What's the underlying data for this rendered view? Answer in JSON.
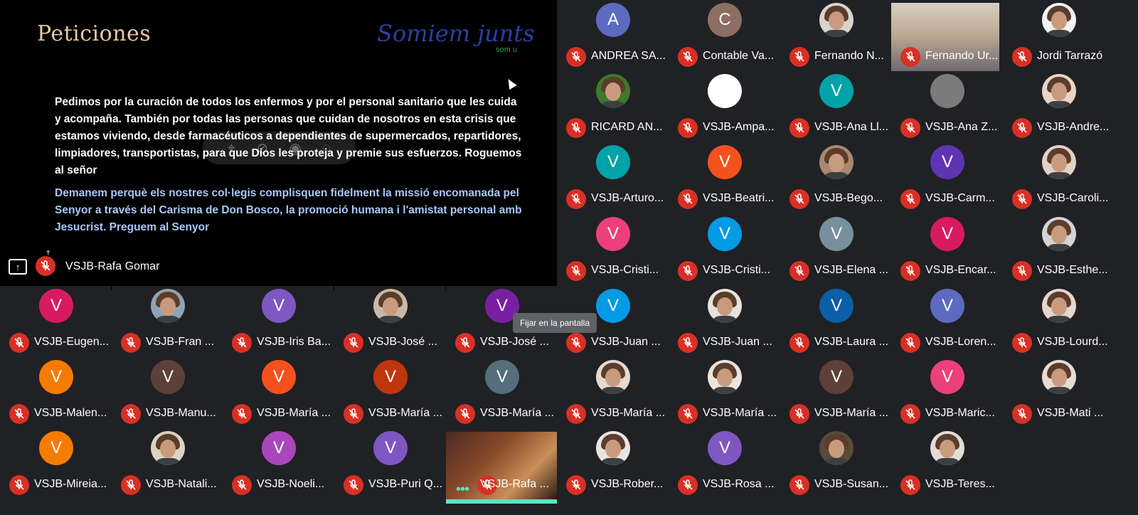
{
  "presentation": {
    "title": "Peticiones",
    "logo": "Somiem junts",
    "logo_sub": "som u",
    "paragraph_es": "Pedimos por la curación de todos los enfermos y por el personal sanitario que les cuida y acompaña. También por todas las personas que cuidan de nosotros en esta crisis que estamos viviendo, desde farmacéuticos a dependientes de supermercados, repartidores, limpiadores, transportistas, para que Dios les proteja y premie sus esfuerzos. Roguemos al señor",
    "paragraph_ca": "Demanem perquè els nostres col·legis complisquen fidelment la missió encomanada pel Senyor a través del Carisma de Don Bosco, la promoció humana i l'amistat personal amb Jesucrist. Preguem al Senyor",
    "presenter_name": "VSJB-Rafa Gomar"
  },
  "tooltip": "Fijar en la pantalla",
  "participants": [
    {
      "name": "ANDREA SA...",
      "initial": "A",
      "color": "#5c6bc0",
      "kind": "letter"
    },
    {
      "name": "Contable Va...",
      "initial": "C",
      "color": "#8d6e63",
      "kind": "letter"
    },
    {
      "name": "Fernando N...",
      "initial": "",
      "color": "#d9d3cc",
      "kind": "photo"
    },
    {
      "name": "Fernando Ur...",
      "initial": "",
      "color": "#b8a898",
      "kind": "video"
    },
    {
      "name": "Jordi Tarrazó",
      "initial": "",
      "color": "#f2f2f2",
      "kind": "photo"
    },
    {
      "name": "RICARD AN...",
      "initial": "",
      "color": "#3d7a2a",
      "kind": "photo"
    },
    {
      "name": "VSJB-Ampa...",
      "initial": "",
      "color": "#ffffff",
      "kind": "blank"
    },
    {
      "name": "VSJB-Ana Ll...",
      "initial": "V",
      "color": "#00a3a8",
      "kind": "letter"
    },
    {
      "name": "VSJB-Ana Z...",
      "initial": "",
      "color": "#7b7b7b",
      "kind": "blank"
    },
    {
      "name": "VSJB-Andre...",
      "initial": "",
      "color": "#e8d5c8",
      "kind": "photo"
    },
    {
      "name": "VSJB-Arturo...",
      "initial": "V",
      "color": "#00a3a8",
      "kind": "letter"
    },
    {
      "name": "VSJB-Beatri...",
      "initial": "V",
      "color": "#f4511e",
      "kind": "letter"
    },
    {
      "name": "VSJB-Bego...",
      "initial": "",
      "color": "#a88870",
      "kind": "photo"
    },
    {
      "name": "VSJB-Carm...",
      "initial": "V",
      "color": "#5e35b1",
      "kind": "letter"
    },
    {
      "name": "VSJB-Caroli...",
      "initial": "",
      "color": "#e0d2c4",
      "kind": "photo"
    },
    {
      "name": "VSJB-Cristi...",
      "initial": "V",
      "color": "#ec407a",
      "kind": "letter"
    },
    {
      "name": "VSJB-Cristi...",
      "initial": "V",
      "color": "#039be5",
      "kind": "letter"
    },
    {
      "name": "VSJB-Elena ...",
      "initial": "V",
      "color": "#78909c",
      "kind": "letter"
    },
    {
      "name": "VSJB-Encar...",
      "initial": "V",
      "color": "#d81b60",
      "kind": "letter"
    },
    {
      "name": "VSJB-Esthe...",
      "initial": "",
      "color": "#d4d4d4",
      "kind": "photo"
    },
    {
      "name": "VSJB-Eugen...",
      "initial": "V",
      "color": "#d81b60",
      "kind": "letter"
    },
    {
      "name": "VSJB-Fran ...",
      "initial": "",
      "color": "#8fa3b5",
      "kind": "photo"
    },
    {
      "name": "VSJB-Iris Ba...",
      "initial": "V",
      "color": "#7e57c2",
      "kind": "letter"
    },
    {
      "name": "VSJB-José ...",
      "initial": "",
      "color": "#c9b8a8",
      "kind": "photo"
    },
    {
      "name": "VSJB-José ...",
      "initial": "V",
      "color": "#7b1fa2",
      "kind": "letter"
    },
    {
      "name": "VSJB-Juan ...",
      "initial": "V",
      "color": "#039be5",
      "kind": "letter"
    },
    {
      "name": "VSJB-Juan ...",
      "initial": "",
      "color": "#e8e2dc",
      "kind": "photo"
    },
    {
      "name": "VSJB-Laura ...",
      "initial": "V",
      "color": "#0b5ea8",
      "kind": "letter"
    },
    {
      "name": "VSJB-Loren...",
      "initial": "V",
      "color": "#5c6bc0",
      "kind": "letter"
    },
    {
      "name": "VSJB-Lourd...",
      "initial": "",
      "color": "#e6d6cc",
      "kind": "photo"
    },
    {
      "name": "VSJB-Malen...",
      "initial": "V",
      "color": "#f57c00",
      "kind": "letter"
    },
    {
      "name": "VSJB-Manu...",
      "initial": "V",
      "color": "#5d4037",
      "kind": "letter"
    },
    {
      "name": "VSJB-María ...",
      "initial": "V",
      "color": "#f4511e",
      "kind": "letter"
    },
    {
      "name": "VSJB-María ...",
      "initial": "V",
      "color": "#bf360c",
      "kind": "letter"
    },
    {
      "name": "VSJB-María ...",
      "initial": "V",
      "color": "#546e7a",
      "kind": "letter"
    },
    {
      "name": "VSJB-María ...",
      "initial": "",
      "color": "#e4d8d0",
      "kind": "photo"
    },
    {
      "name": "VSJB-María ...",
      "initial": "",
      "color": "#ece4de",
      "kind": "photo"
    },
    {
      "name": "VSJB-María ...",
      "initial": "V",
      "color": "#5d4037",
      "kind": "letter"
    },
    {
      "name": "VSJB-Maric...",
      "initial": "V",
      "color": "#ec407a",
      "kind": "letter"
    },
    {
      "name": "VSJB-Mati ...",
      "initial": "",
      "color": "#e6dcd2",
      "kind": "photo"
    },
    {
      "name": "VSJB-Mireia...",
      "initial": "V",
      "color": "#f57c00",
      "kind": "letter"
    },
    {
      "name": "VSJB-Natali...",
      "initial": "",
      "color": "#dcd2c4",
      "kind": "photo"
    },
    {
      "name": "VSJB-Noeli...",
      "initial": "V",
      "color": "#ab47bc",
      "kind": "letter"
    },
    {
      "name": "VSJB-Puri Q...",
      "initial": "V",
      "color": "#7e57c2",
      "kind": "letter"
    },
    {
      "name": "VSJB-Rafa ...",
      "initial": "",
      "color": "#5a3020",
      "kind": "video"
    },
    {
      "name": "VSJB-Rober...",
      "initial": "",
      "color": "#e8e4e0",
      "kind": "photo"
    },
    {
      "name": "VSJB-Rosa ...",
      "initial": "V",
      "color": "#7e57c2",
      "kind": "letter"
    },
    {
      "name": "VSJB-Susan...",
      "initial": "",
      "color": "#5a4a3a",
      "kind": "photo"
    },
    {
      "name": "VSJB-Teres...",
      "initial": "",
      "color": "#e4ddd6",
      "kind": "photo"
    }
  ]
}
